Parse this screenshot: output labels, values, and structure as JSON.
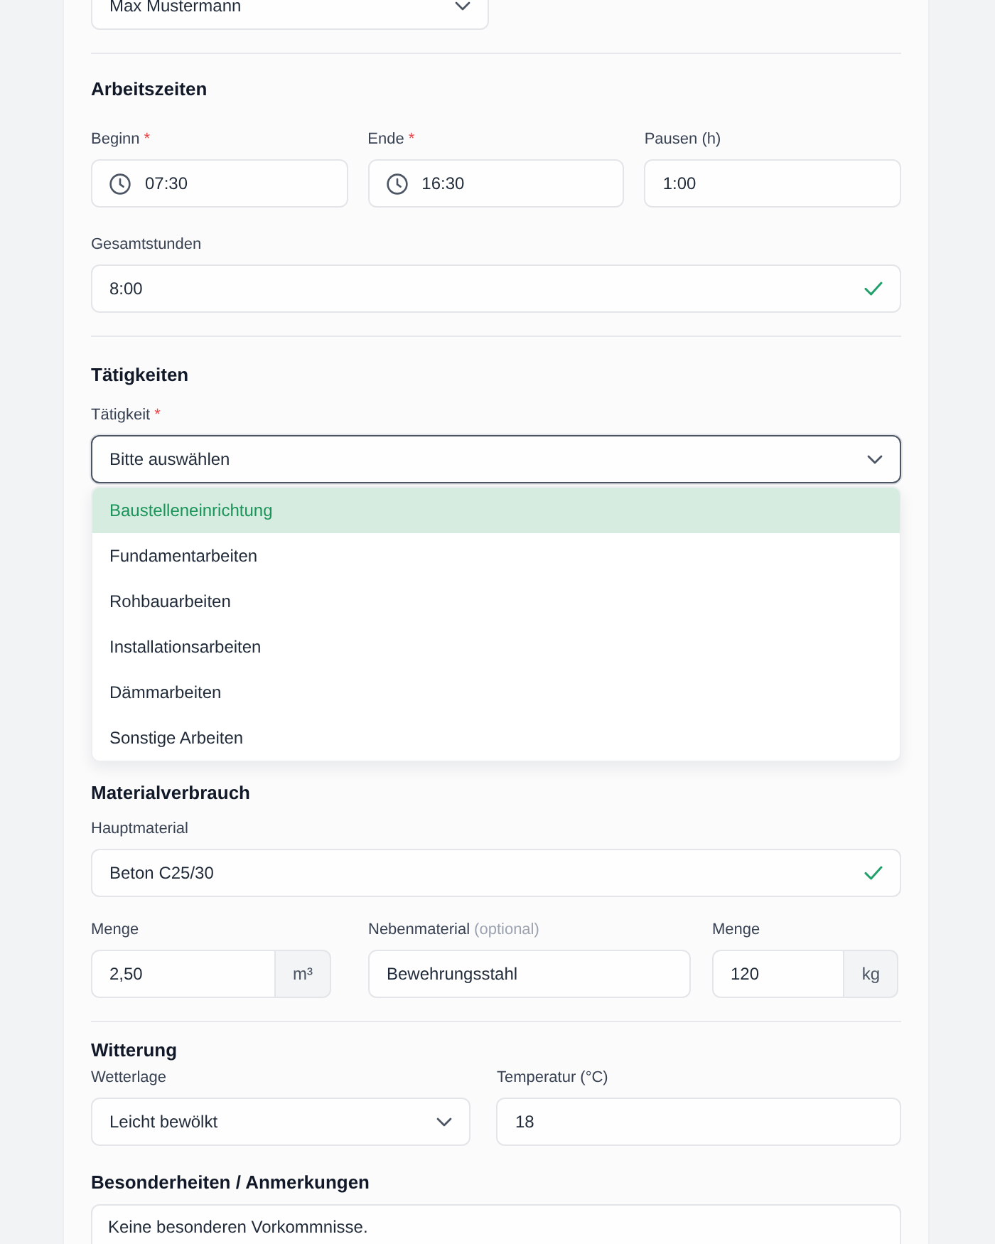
{
  "top_field": {
    "kind": "select",
    "value": "Max Mustermann",
    "divider": true
  },
  "sections": [
    {
      "title": "Arbeitszeiten",
      "divider": true,
      "rows": [
        [
          {
            "kind": "time",
            "label": "Beginn",
            "mark": "*",
            "value": "07:30"
          },
          {
            "kind": "time",
            "label": "Ende",
            "mark": "*",
            "value": "16:30"
          },
          {
            "kind": "text",
            "label": "Pausen (h)",
            "value": "1:00"
          }
        ],
        [
          {
            "kind": "text",
            "label": "Gesamtstunden",
            "value": "8:00",
            "valid": true
          }
        ]
      ]
    },
    {
      "title": "Tätigkeiten",
      "divider": false,
      "rows": [
        [
          {
            "kind": "select",
            "label": "Tätigkeit",
            "mark": "*",
            "value": "Bitte auswählen",
            "focused": true,
            "options": [
              {
                "label": "Baustelleneinrichtung",
                "selected": true
              },
              {
                "label": "Fundamentarbeiten",
                "selected": false
              },
              {
                "label": "Rohbauarbeiten",
                "selected": false
              },
              {
                "label": "Installationsarbeiten",
                "selected": false
              },
              {
                "label": "Dämmarbeiten",
                "selected": false
              },
              {
                "label": "Sonstige Arbeiten",
                "selected": false
              }
            ]
          }
        ]
      ]
    },
    {
      "title": "Materialverbrauch",
      "divider": true,
      "rows": [
        [
          {
            "kind": "text",
            "label": "Hauptmaterial",
            "value": "Beton C25/30",
            "valid": true
          }
        ],
        [
          {
            "kind": "text",
            "label": "Menge",
            "value": "2,50",
            "unit": "m³"
          },
          {
            "kind": "text",
            "label": "Nebenmaterial",
            "hint": "(optional)",
            "value": "Bewehrungsstahl"
          },
          {
            "kind": "text",
            "label": "Menge",
            "value": "120",
            "unit": "kg"
          }
        ]
      ]
    },
    {
      "title": "Witterung",
      "divider": false,
      "rows": [
        [
          {
            "kind": "select",
            "label": "Wetterlage",
            "value": "Leicht bewölkt"
          },
          {
            "kind": "text",
            "label": "Temperatur (°C)",
            "value": "18"
          }
        ]
      ]
    },
    {
      "title": "Besonderheiten / Anmerkungen",
      "divider": false,
      "rows": [
        [
          {
            "kind": "textarea",
            "value": "Keine besonderen Vorkommnisse."
          }
        ]
      ]
    }
  ]
}
